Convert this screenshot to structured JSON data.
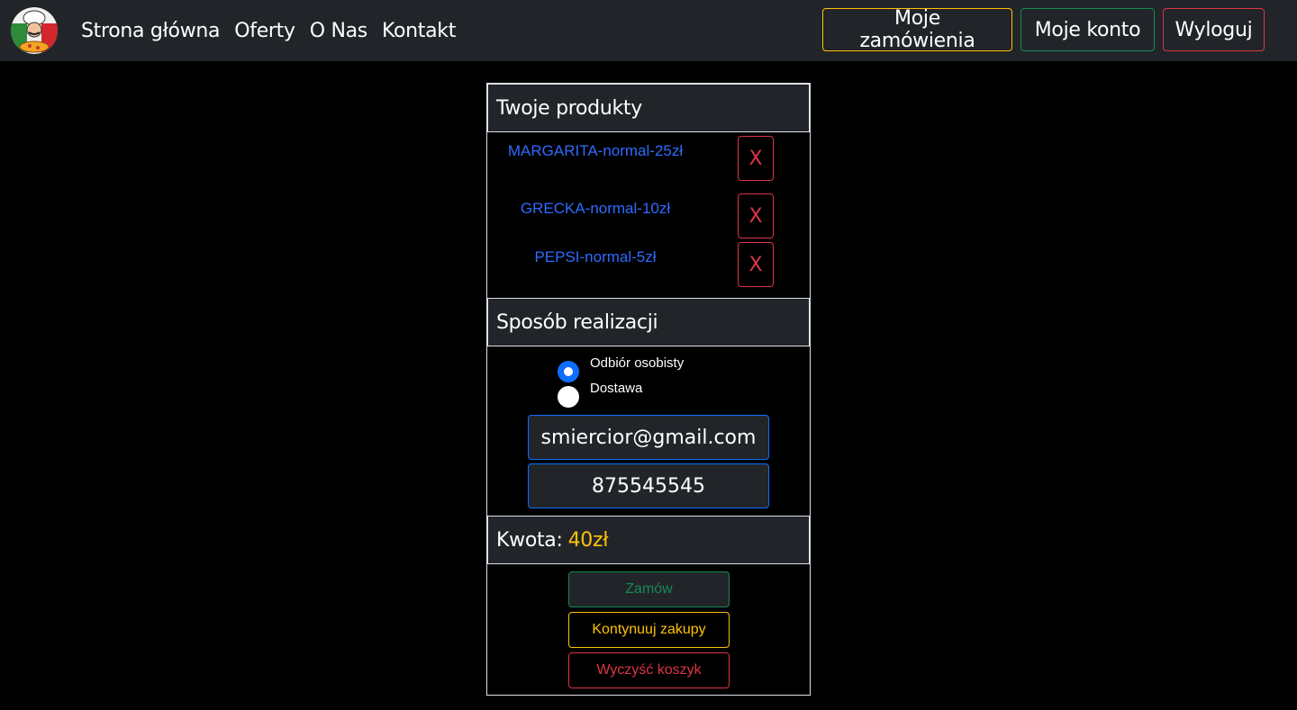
{
  "navbar": {
    "logo_icon": "chef-pizza-logo-icon",
    "links": [
      "Strona główna",
      "Oferty",
      "O Nas",
      "Kontakt"
    ],
    "buttons": {
      "orders": "Moje zamówienia",
      "account": "Moje konto",
      "logout": "Wyloguj"
    }
  },
  "cart": {
    "products_title": "Twoje produkty",
    "products": [
      {
        "name": "MARGARITA-normal-25zł",
        "remove_label": "X"
      },
      {
        "name": "GRECKA-normal-10zł",
        "remove_label": "X"
      },
      {
        "name": "PEPSI-normal-5zł",
        "remove_label": "X"
      }
    ],
    "delivery_title": "Sposób realizacji",
    "delivery_options": [
      {
        "label": "Odbiór osobisty",
        "checked": true
      },
      {
        "label": "Dostawa",
        "checked": false
      }
    ],
    "email_value": "smiercior@gmail.com",
    "phone_value": "875545545",
    "amount_label": "Kwota:",
    "amount_value": "40zł",
    "actions": {
      "order": "Zamów",
      "continue": "Kontynuuj zakupy",
      "clear": "Wyczyść koszyk"
    }
  },
  "colors": {
    "navbar_bg": "#212529",
    "primary": "#0d6efd",
    "success": "#198754",
    "warning": "#ffc107",
    "danger": "#dc3545",
    "product_link": "#2f6bff"
  }
}
